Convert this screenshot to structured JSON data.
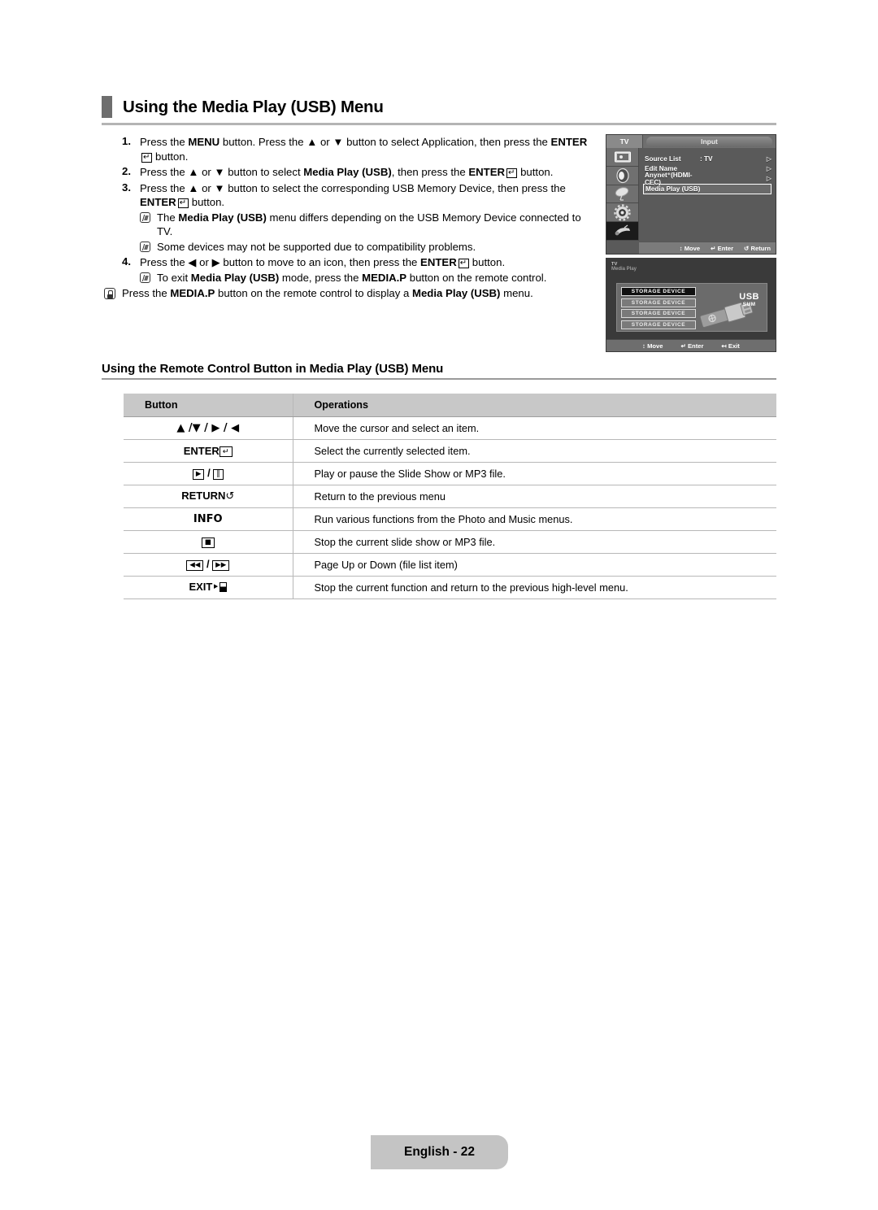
{
  "section": {
    "title": "Using the Media Play (USB) Menu"
  },
  "steps": [
    {
      "num": "1.",
      "parts": [
        {
          "t": "Press the ",
          "b": false
        },
        {
          "t": "MENU",
          "b": true
        },
        {
          "t": " button. Press the ▲ or ▼ button to select Application, then press the ",
          "b": false
        },
        {
          "t": "ENTER",
          "b": true
        },
        {
          "t": "KEY",
          "b": false
        },
        {
          "t": " button.",
          "b": false
        }
      ],
      "notes": []
    },
    {
      "num": "2.",
      "parts": [
        {
          "t": "Press the ▲ or ▼ button to select ",
          "b": false
        },
        {
          "t": "Media Play (USB)",
          "b": true
        },
        {
          "t": ", then press the ",
          "b": false
        },
        {
          "t": "ENTER",
          "b": true
        },
        {
          "t": "KEY",
          "b": false
        },
        {
          "t": " button.",
          "b": false
        }
      ],
      "notes": []
    },
    {
      "num": "3.",
      "parts": [
        {
          "t": "Press the ▲ or ▼ button to select the corresponding USB Memory Device, then press the ",
          "b": false
        },
        {
          "t": "ENTER",
          "b": true
        },
        {
          "t": "KEY",
          "b": false
        },
        {
          "t": " button.",
          "b": false
        }
      ],
      "notes": [
        [
          {
            "t": "The ",
            "b": false
          },
          {
            "t": "Media Play (USB)",
            "b": true
          },
          {
            "t": " menu differs depending on the USB Memory Device connected to TV.",
            "b": false
          }
        ],
        [
          {
            "t": "Some devices may not be supported due to compatibility problems.",
            "b": false
          }
        ]
      ]
    },
    {
      "num": "4.",
      "parts": [
        {
          "t": "Press the ◀ or ▶ button to move to an icon, then press the ",
          "b": false
        },
        {
          "t": "ENTER",
          "b": true
        },
        {
          "t": "KEY",
          "b": false
        },
        {
          "t": " button.",
          "b": false
        }
      ],
      "notes": [
        [
          {
            "t": "To exit ",
            "b": false
          },
          {
            "t": "Media Play (USB)",
            "b": true
          },
          {
            "t": " mode, press the ",
            "b": false
          },
          {
            "t": "MEDIA.P",
            "b": true
          },
          {
            "t": " button on the remote control.",
            "b": false
          }
        ]
      ]
    }
  ],
  "tip": {
    "icon": "hand-tip-icon",
    "parts": [
      {
        "t": "Press the ",
        "b": false
      },
      {
        "t": "MEDIA.P",
        "b": true
      },
      {
        "t": " button on the remote control to display a ",
        "b": false
      },
      {
        "t": "Media Play (USB)",
        "b": true
      },
      {
        "t": " menu.",
        "b": false
      }
    ]
  },
  "tv_menu": {
    "tab_label": "TV",
    "panel_title": "Input",
    "rail_icons": [
      "picture-icon",
      "sound-icon",
      "channel-icon",
      "setup-icon",
      "input-icon"
    ],
    "rail_selected_index": 4,
    "items": [
      {
        "label": "Source List",
        "value": ": TV",
        "arrow": "▷",
        "highlighted": false
      },
      {
        "label": "Edit Name",
        "value": "",
        "arrow": "▷",
        "highlighted": false
      },
      {
        "label": "Anynet⁺(HDMI-CEC)",
        "value": "",
        "arrow": "▷",
        "highlighted": false
      },
      {
        "label": "Media Play (USB)",
        "value": "",
        "arrow": "",
        "highlighted": true
      }
    ],
    "footer": [
      {
        "glyph": "↕",
        "label": "Move"
      },
      {
        "glyph": "↵",
        "label": "Enter"
      },
      {
        "glyph": "↺",
        "label": "Return"
      }
    ]
  },
  "usb_screen": {
    "head_line1": "TV",
    "head_line2": "Media Play",
    "devices": [
      {
        "label": "STORAGE DEVICE",
        "selected": true
      },
      {
        "label": "STORAGE DEVICE",
        "selected": false
      },
      {
        "label": "STORAGE DEVICE",
        "selected": false
      },
      {
        "label": "STORAGE DEVICE",
        "selected": false
      }
    ],
    "usb_title": "USB",
    "usb_sub": "SUM",
    "footer": [
      {
        "glyph": "↕",
        "label": "Move"
      },
      {
        "glyph": "↵",
        "label": "Enter"
      },
      {
        "glyph": "↤",
        "label": "Exit"
      }
    ]
  },
  "subsection": {
    "title": "Using the Remote Control Button in Media Play (USB) Menu"
  },
  "table": {
    "headers": [
      "Button",
      "Operations"
    ],
    "rows": [
      {
        "button_kind": "text",
        "button": "▲ /▼ / ▶ / ◀",
        "operation": "Move the cursor and select an item."
      },
      {
        "button_kind": "enter",
        "button": "ENTER",
        "operation": "Select the currently selected item."
      },
      {
        "button_kind": "playpause",
        "button": "▶ / ‖",
        "operation": "Play or pause the Slide Show or MP3 file."
      },
      {
        "button_kind": "return",
        "button": "RETURN",
        "operation": "Return to the previous menu"
      },
      {
        "button_kind": "text",
        "button": "INFO",
        "operation": "Run various functions from the Photo and Music menus."
      },
      {
        "button_kind": "stop",
        "button": "■",
        "operation": "Stop the current slide show or MP3 file."
      },
      {
        "button_kind": "skip",
        "button": "◀◀ / ▶▶",
        "operation": "Page Up or Down (file list item)"
      },
      {
        "button_kind": "exit",
        "button": "EXIT",
        "operation": "Stop the current function and return to the previous high-level menu."
      }
    ]
  },
  "footer": {
    "label": "English - 22"
  }
}
